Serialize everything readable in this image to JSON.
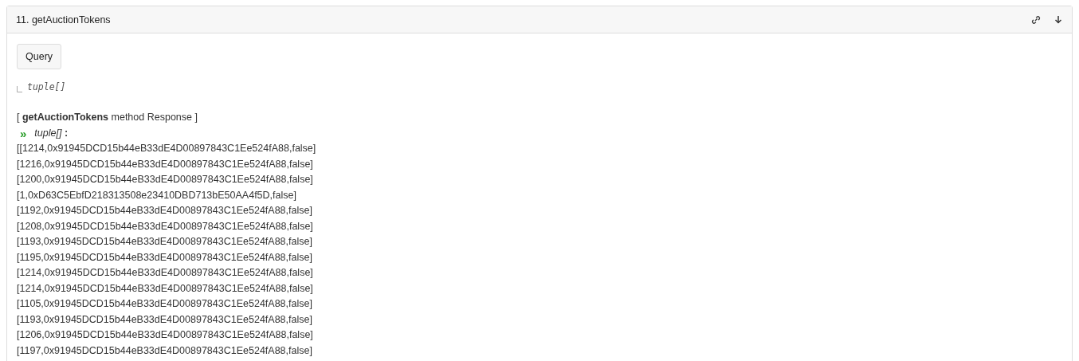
{
  "header": {
    "title": "11. getAuctionTokens"
  },
  "query_button": "Query",
  "output_type": "tuple[]",
  "response": {
    "heading": "[ **getAuctionTokens** method Response ]",
    "output_marker": "»",
    "output_label": "*tuple[]* **:**",
    "lines": [
      "[[1214,0x91945DCD15b44eB33dE4D00897843C1Ee524fA88,false]",
      "[1216,0x91945DCD15b44eB33dE4D00897843C1Ee524fA88,false]",
      "[1200,0x91945DCD15b44eB33dE4D00897843C1Ee524fA88,false]",
      "[1,0xD63C5EbfD218313508e23410DBD713bE50AA4f5D,false]",
      "[1192,0x91945DCD15b44eB33dE4D00897843C1Ee524fA88,false]",
      "[1208,0x91945DCD15b44eB33dE4D00897843C1Ee524fA88,false]",
      "[1193,0x91945DCD15b44eB33dE4D00897843C1Ee524fA88,false]",
      "[1195,0x91945DCD15b44eB33dE4D00897843C1Ee524fA88,false]",
      "[1214,0x91945DCD15b44eB33dE4D00897843C1Ee524fA88,false]",
      "[1214,0x91945DCD15b44eB33dE4D00897843C1Ee524fA88,false]",
      "[1105,0x91945DCD15b44eB33dE4D00897843C1Ee524fA88,false]",
      "[1193,0x91945DCD15b44eB33dE4D00897843C1Ee524fA88,false]",
      "[1206,0x91945DCD15b44eB33dE4D00897843C1Ee524fA88,false]",
      "[1197,0x91945DCD15b44eB33dE4D00897843C1Ee524fA88,false]"
    ]
  }
}
